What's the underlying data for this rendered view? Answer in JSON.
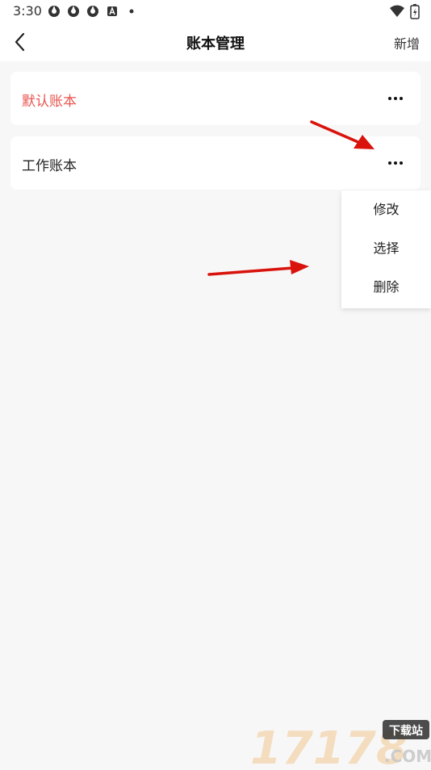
{
  "status_bar": {
    "time": "3:30",
    "icons": [
      "app-icon",
      "app-icon",
      "app-icon",
      "a-icon",
      "dot-icon"
    ],
    "right_icons": [
      "wifi-icon",
      "battery-icon"
    ]
  },
  "header": {
    "title": "账本管理",
    "add_label": "新增"
  },
  "books": [
    {
      "name": "默认账本",
      "color": "#e8544f"
    },
    {
      "name": "工作账本",
      "color": "#222222"
    }
  ],
  "popup_menu": {
    "items": [
      "修改",
      "选择",
      "删除"
    ]
  },
  "watermark": {
    "site_number": "17178",
    "badge": "下载站",
    "domain": ".COM"
  },
  "colors": {
    "accent_red": "#e8544f",
    "arrow_red": "#d9120c"
  }
}
